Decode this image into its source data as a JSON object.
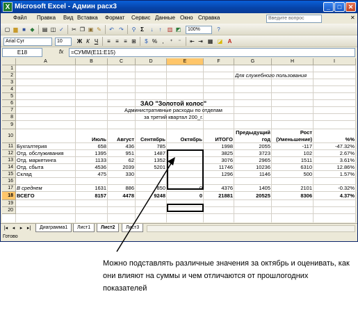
{
  "window": {
    "title": "Microsoft Excel - Админ расх3",
    "app_icon": "X"
  },
  "window_buttons": {
    "minimize": "_",
    "maximize": "□",
    "close": "✕"
  },
  "menu": [
    "Файл",
    "Правка",
    "Вид",
    "Вставка",
    "Формат",
    "Сервис",
    "Данные",
    "Окно",
    "Справка"
  ],
  "help_placeholder": "Введите вопрос",
  "toolbar": {
    "zoom": "100%"
  },
  "format_toolbar": {
    "font": "Arial Cyr",
    "size": "10",
    "bold": "Ж",
    "italic": "К",
    "underline": "Ч"
  },
  "namebox": "E18",
  "fx": "fx",
  "formula": "=СУММ(E11:E15)",
  "columns": [
    "A",
    "B",
    "C",
    "D",
    "E",
    "F",
    "G",
    "H",
    "I"
  ],
  "rows": [
    "1",
    "2",
    "3",
    "4",
    "5",
    "6",
    "7",
    "8",
    "9",
    "10",
    "11",
    "12",
    "13",
    "14",
    "15",
    "16",
    "17",
    "18",
    "19",
    "20"
  ],
  "sheet": {
    "service_note": "Для служебного пользования",
    "company": "ЗАО \"Золотой колос\"",
    "subtitle1": "Административные расходы по отделам",
    "subtitle2": "за третий квартал 200_г.",
    "headers": {
      "jul": "Июль",
      "aug": "Август",
      "sep": "Сентябрь",
      "oct": "Октябрь",
      "total": "ИТОГО",
      "prev1": "Предыдущий",
      "prev2": "год",
      "growth1": "Рост",
      "growth2": "(Уменьшение)",
      "pct": "%%"
    },
    "data_rows": [
      {
        "name": "Бухгалтерия",
        "jul": "658",
        "aug": "436",
        "sep": "785",
        "oct": "",
        "total": "1998",
        "prev": "2055",
        "growth": "-117",
        "pct": "-47.32%"
      },
      {
        "name": "Отд. обслуживания",
        "jul": "1395",
        "aug": "951",
        "sep": "1487",
        "oct": "",
        "total": "3825",
        "prev": "3723",
        "growth": "102",
        "pct": "2.67%"
      },
      {
        "name": "Отд. маркетинга",
        "jul": "1133",
        "aug": "62",
        "sep": "1352",
        "oct": "",
        "total": "3076",
        "prev": "2965",
        "growth": "1511",
        "pct": "3.61%"
      },
      {
        "name": "Отд. сбыта",
        "jul": "4536",
        "aug": "2039",
        "sep": "5201",
        "oct": "",
        "total": "11746",
        "prev": "10236",
        "growth": "6310",
        "pct": "12.86%"
      },
      {
        "name": "Склад",
        "jul": "475",
        "aug": "330",
        "sep": "",
        "oct": "",
        "total": "1296",
        "prev": "1146",
        "growth": "500",
        "pct": "1.57%"
      }
    ],
    "avg": {
      "name": "В среднем",
      "jul": "1631",
      "aug": "886",
      "sep": "850",
      "oct": "0",
      "total": "4376",
      "prev": "1405",
      "growth": "2101",
      "pct": "-0.32%"
    },
    "total": {
      "name": "ВСЕГО",
      "jul": "8157",
      "aug": "4478",
      "sep": "9248",
      "oct": "0",
      "total": "21881",
      "prev": "20525",
      "growth": "8306",
      "pct": "4.37%"
    }
  },
  "tabs": [
    "Диаграмма1",
    "Лист1",
    "Лист2",
    "Лист3"
  ],
  "active_tab": "Лист2",
  "status": "Готово",
  "caption": "Можно подставлять различные значения за октябрь и оценивать, как они влияют на суммы и чем отличаются от прошлогодних показателей"
}
